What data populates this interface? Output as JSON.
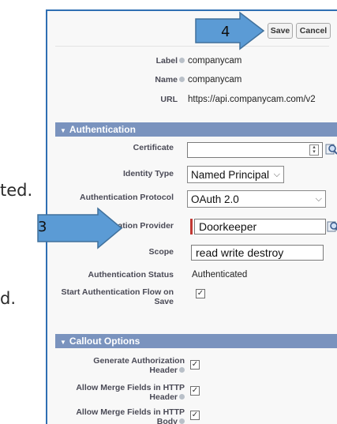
{
  "background": {
    "fragment_1": "ted.",
    "fragment_2": "d."
  },
  "callouts": {
    "step_4": "4",
    "step_3": "3"
  },
  "toolbar": {
    "save_label": "Save",
    "cancel_label": "Cancel"
  },
  "info": {
    "label_label": "Label",
    "label_value": "companycam",
    "name_label": "Name",
    "name_value": "companycam",
    "url_label": "URL",
    "url_value": "https://api.companycam.com/v2"
  },
  "authentication": {
    "section_title": "Authentication",
    "certificate_label": "Certificate",
    "identity_type_label": "Identity Type",
    "identity_type_value": "Named Principal",
    "auth_protocol_label": "Authentication Protocol",
    "auth_protocol_value": "OAuth 2.0",
    "auth_provider_label": "Authentication Provider",
    "auth_provider_value": "Doorkeeper",
    "scope_label": "Scope",
    "scope_value": "read write destroy",
    "auth_status_label": "Authentication Status",
    "auth_status_value": "Authenticated",
    "start_flow_label": "Start Authentication Flow on Save",
    "start_flow_checked": true
  },
  "callout_options": {
    "section_title": "Callout Options",
    "generate_auth_header_label": "Generate Authorization Header",
    "merge_fields_header_label": "Allow Merge Fields in HTTP Header",
    "merge_fields_body_label": "Allow Merge Fields in HTTP Body"
  },
  "colors": {
    "section_bg": "#7a93be",
    "arrow_fill": "#5b9bd5",
    "required_bar": "#c23934"
  }
}
